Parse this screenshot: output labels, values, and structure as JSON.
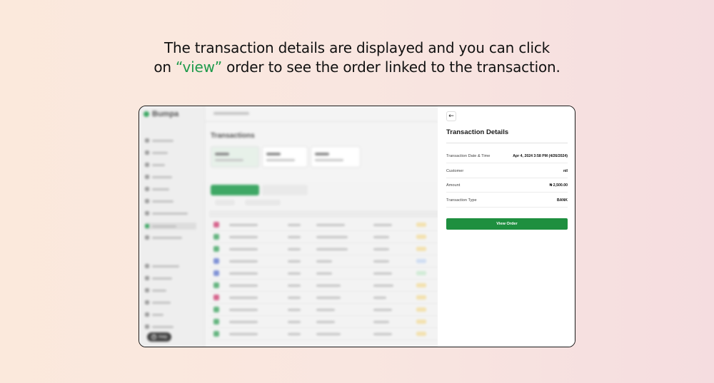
{
  "headline": {
    "line1": "The transaction details are displayed and you can click",
    "line2_prefix": "on ",
    "line2_highlight": "“view”",
    "line2_suffix": " order to see the order linked to the transaction."
  },
  "background_app": {
    "brand": "Bumpa",
    "page_title": "Transactions",
    "help_label": "Help"
  },
  "panel": {
    "title": "Transaction Details",
    "rows": [
      {
        "label": "Transaction Date & Time",
        "value": "Apr 4, 2024 3:58 PM (4/26/2024)"
      },
      {
        "label": "Customer",
        "value": "nil"
      },
      {
        "label": "Amount",
        "value": "₦ 2,500.00"
      },
      {
        "label": "Transaction Type",
        "value": "BANK"
      }
    ],
    "view_order_label": "View Order"
  },
  "colors": {
    "accent": "#1e9a4b",
    "button": "#1e8f3f"
  },
  "icons": {
    "back": "arrow-left-icon",
    "help": "question-icon"
  }
}
